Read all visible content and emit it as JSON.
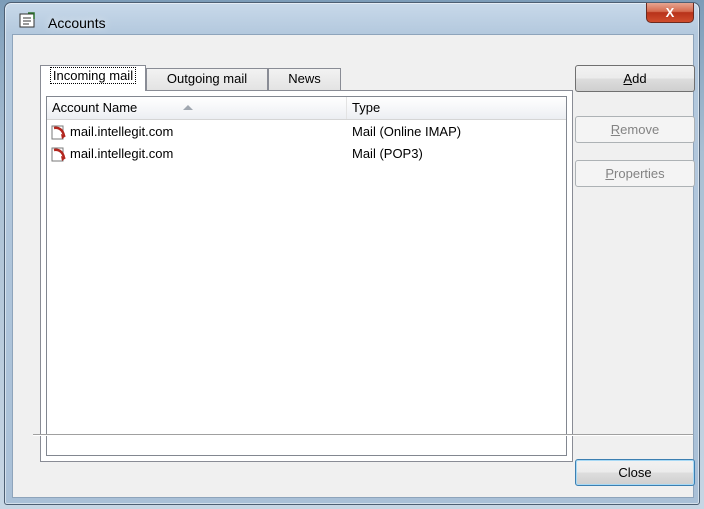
{
  "window": {
    "title": "Accounts",
    "close_glyph": "X"
  },
  "tabs": [
    {
      "label": "Incoming mail",
      "active": true
    },
    {
      "label": "Outgoing mail",
      "active": false
    },
    {
      "label": "News",
      "active": false
    }
  ],
  "list": {
    "columns": [
      "Account Name",
      "Type"
    ],
    "sort_column": "Account Name",
    "sort_direction": "ascending",
    "rows": [
      {
        "name": "mail.intellegit.com",
        "type": "Mail (Online IMAP)",
        "icon": "mail-account-icon"
      },
      {
        "name": "mail.intellegit.com",
        "type": "Mail (POP3)",
        "icon": "mail-account-icon"
      }
    ]
  },
  "buttons": {
    "add": {
      "mnemonic": "A",
      "rest": "dd",
      "enabled": true
    },
    "remove": {
      "mnemonic": "R",
      "rest": "emove",
      "enabled": false
    },
    "properties": {
      "mnemonic": "P",
      "rest": "roperties",
      "enabled": false
    },
    "close": {
      "label": "Close",
      "enabled": true
    }
  }
}
